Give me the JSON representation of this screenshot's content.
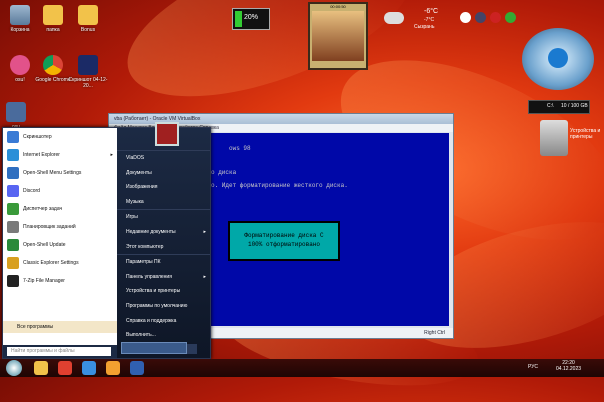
{
  "desktop_icons": [
    {
      "label": "Корзина",
      "color": "#6d8fb0"
    },
    {
      "label": "папка",
      "color": "#f2c24a"
    },
    {
      "label": "Bonus",
      "color": "#f2c24a"
    },
    {
      "label": "osu!",
      "color": "#e2528a"
    },
    {
      "label": "Google Chrome",
      "color": "#3a8fe0"
    },
    {
      "label": "Скриншот 04-12-20...",
      "color": "#1b2a66"
    },
    {
      "label": "osu",
      "color": "#4a6b9c"
    }
  ],
  "gadgets": {
    "battery": "20%",
    "clock_face": "00:00:50",
    "weather_temp": "-6°C",
    "weather_range": "-7°C",
    "weather_city": "Сызрань",
    "drive_c": "C:\\",
    "drive_c_size": "10 / 100 GB",
    "trash_label": "Устройства и принтеры"
  },
  "vm": {
    "title": "vba (Работает) - Oracle VM VirtualBox",
    "menu": "Файл  Машина  Вид  Ввод  Устройства  Справка",
    "line1": "ows 98",
    "line2": "о диска",
    "line3": "о. Идет форматирование жесткого диска.",
    "box_line1": "Форматирование диска C",
    "box_line2": "100% отформатировано",
    "status_key": "Right Ctrl"
  },
  "start_menu": {
    "left_items": [
      {
        "label": "Скриншотер",
        "color": "#3a7bd5",
        "arrow": ""
      },
      {
        "label": "Internet Explorer",
        "color": "#2a8fd8",
        "arrow": "▸"
      },
      {
        "label": "Open-Shell Menu Settings",
        "color": "#2f6fc0",
        "arrow": ""
      },
      {
        "label": "Discord",
        "color": "#5865f2",
        "arrow": ""
      },
      {
        "label": "Диспетчер задач",
        "color": "#3a9a3a",
        "arrow": ""
      },
      {
        "label": "Планировщик заданий",
        "color": "#7a7a7a",
        "arrow": ""
      },
      {
        "label": "Open-Shell Update",
        "color": "#2a8a3a",
        "arrow": ""
      },
      {
        "label": "Classic Explorer Settings",
        "color": "#d8a020",
        "arrow": ""
      },
      {
        "label": "7-Zip File Manager",
        "color": "#222222",
        "arrow": ""
      }
    ],
    "all_programs": "Все программы",
    "search_placeholder": "Найти программы и файлы",
    "right_items": [
      {
        "label": "VlaDOS",
        "arrow": ""
      },
      {
        "label": "Документы",
        "arrow": ""
      },
      {
        "label": "Изображения",
        "arrow": ""
      },
      {
        "label": "Музыка",
        "arrow": ""
      },
      {
        "label": "Игры",
        "arrow": ""
      },
      {
        "label": "Недавние документы",
        "arrow": "▸"
      },
      {
        "label": "Этот компьютер",
        "arrow": ""
      },
      {
        "label": "Параметры ПК",
        "arrow": ""
      },
      {
        "label": "Панель управления",
        "arrow": "▸"
      },
      {
        "label": "Устройства и принтеры",
        "arrow": ""
      },
      {
        "label": "Программы по умолчанию",
        "arrow": ""
      },
      {
        "label": "Справка и поддержка",
        "arrow": ""
      },
      {
        "label": "Выполнить...",
        "arrow": ""
      }
    ]
  },
  "taskbar": {
    "lang": "РУС",
    "time": "22:20",
    "date": "04.12.2023",
    "apps": [
      {
        "name": "explorer",
        "color": "#f2c24a"
      },
      {
        "name": "media",
        "color": "#e04030"
      },
      {
        "name": "chrome",
        "color": "#3a8fe0"
      },
      {
        "name": "folder",
        "color": "#f2a030"
      },
      {
        "name": "virtualbox",
        "color": "#3060b0"
      }
    ]
  }
}
